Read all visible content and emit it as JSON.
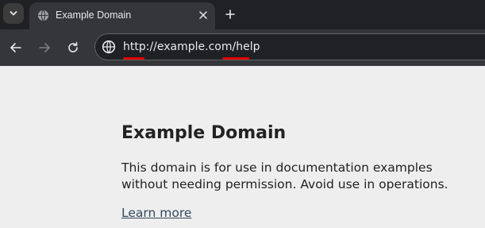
{
  "browser": {
    "tab": {
      "title": "Example Domain"
    },
    "address_bar": {
      "url_text": "http://example.com/help"
    },
    "colors": {
      "annotation_underline": "#e00000",
      "tab_strip": "#202124",
      "toolbar": "#35363a"
    },
    "icons": [
      "tab-search-icon",
      "globe-icon",
      "close-icon",
      "plus-icon",
      "back-arrow-icon",
      "forward-arrow-icon",
      "reload-icon",
      "site-info-icon"
    ]
  },
  "page": {
    "heading": "Example Domain",
    "description": "This domain is for use in documentation examples without needing permission. Avoid use in operations.",
    "link_text": "Learn more",
    "colors": {
      "background": "#eeeeee",
      "link": "#34495e"
    }
  }
}
